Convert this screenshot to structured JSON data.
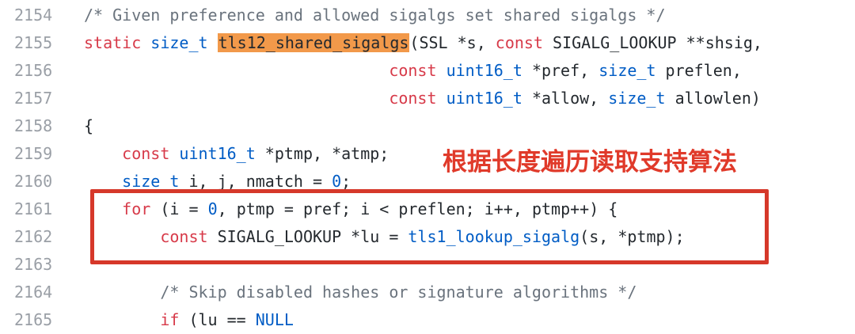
{
  "annotation": "根据长度遍历读取支持算法",
  "colors": {
    "keyword": "#d73a49",
    "type": "#005cc5",
    "comment": "#6a737d",
    "highlight": "#f2994a",
    "annotation": "#e03a2a",
    "box": "#d6382a"
  },
  "lines": [
    {
      "num": "2154",
      "tokens": [
        {
          "t": "/* Given preference and allowed sigalgs set shared sigalgs */",
          "c": "com"
        }
      ]
    },
    {
      "num": "2155",
      "tokens": [
        {
          "t": "static ",
          "c": "kw"
        },
        {
          "t": "size_t ",
          "c": "ty"
        },
        {
          "t": "tls12_shared_sigalgs",
          "c": "hl"
        },
        {
          "t": "(SSL *s, ",
          "c": "txt"
        },
        {
          "t": "const ",
          "c": "kw"
        },
        {
          "t": "SIGALG_LOOKUP **shsig,",
          "c": "txt"
        }
      ]
    },
    {
      "num": "2156",
      "tokens": [
        {
          "t": "                                ",
          "c": "txt"
        },
        {
          "t": "const ",
          "c": "kw"
        },
        {
          "t": "uint16_t ",
          "c": "ty"
        },
        {
          "t": "*pref, ",
          "c": "txt"
        },
        {
          "t": "size_t ",
          "c": "ty"
        },
        {
          "t": "preflen,",
          "c": "txt"
        }
      ]
    },
    {
      "num": "2157",
      "tokens": [
        {
          "t": "                                ",
          "c": "txt"
        },
        {
          "t": "const ",
          "c": "kw"
        },
        {
          "t": "uint16_t ",
          "c": "ty"
        },
        {
          "t": "*allow, ",
          "c": "txt"
        },
        {
          "t": "size_t ",
          "c": "ty"
        },
        {
          "t": "allowlen)",
          "c": "txt"
        }
      ]
    },
    {
      "num": "2158",
      "tokens": [
        {
          "t": "{",
          "c": "txt"
        }
      ]
    },
    {
      "num": "2159",
      "tokens": [
        {
          "t": "    ",
          "c": "txt"
        },
        {
          "t": "const ",
          "c": "kw"
        },
        {
          "t": "uint16_t ",
          "c": "ty"
        },
        {
          "t": "*ptmp, *atmp;",
          "c": "txt"
        }
      ]
    },
    {
      "num": "2160",
      "tokens": [
        {
          "t": "    ",
          "c": "txt"
        },
        {
          "t": "size_t ",
          "c": "ty"
        },
        {
          "t": "i, j, nmatch = ",
          "c": "txt"
        },
        {
          "t": "0",
          "c": "num"
        },
        {
          "t": ";",
          "c": "txt"
        }
      ]
    },
    {
      "num": "2161",
      "tokens": [
        {
          "t": "    ",
          "c": "txt"
        },
        {
          "t": "for ",
          "c": "kw"
        },
        {
          "t": "(i = ",
          "c": "txt"
        },
        {
          "t": "0",
          "c": "num"
        },
        {
          "t": ", ptmp = pref; i < preflen; i++, ptmp++) {",
          "c": "txt"
        }
      ]
    },
    {
      "num": "2162",
      "tokens": [
        {
          "t": "        ",
          "c": "txt"
        },
        {
          "t": "const ",
          "c": "kw"
        },
        {
          "t": "SIGALG_LOOKUP *lu = ",
          "c": "txt"
        },
        {
          "t": "tls1_lookup_sigalg",
          "c": "ty"
        },
        {
          "t": "(s, *ptmp);",
          "c": "txt"
        }
      ]
    },
    {
      "num": "2163",
      "tokens": []
    },
    {
      "num": "2164",
      "tokens": [
        {
          "t": "        ",
          "c": "txt"
        },
        {
          "t": "/* Skip disabled hashes or signature algorithms */",
          "c": "com"
        }
      ]
    },
    {
      "num": "2165",
      "tokens": [
        {
          "t": "        ",
          "c": "txt"
        },
        {
          "t": "if ",
          "c": "kw"
        },
        {
          "t": "(lu == ",
          "c": "txt"
        },
        {
          "t": "NULL",
          "c": "ty"
        }
      ]
    }
  ]
}
